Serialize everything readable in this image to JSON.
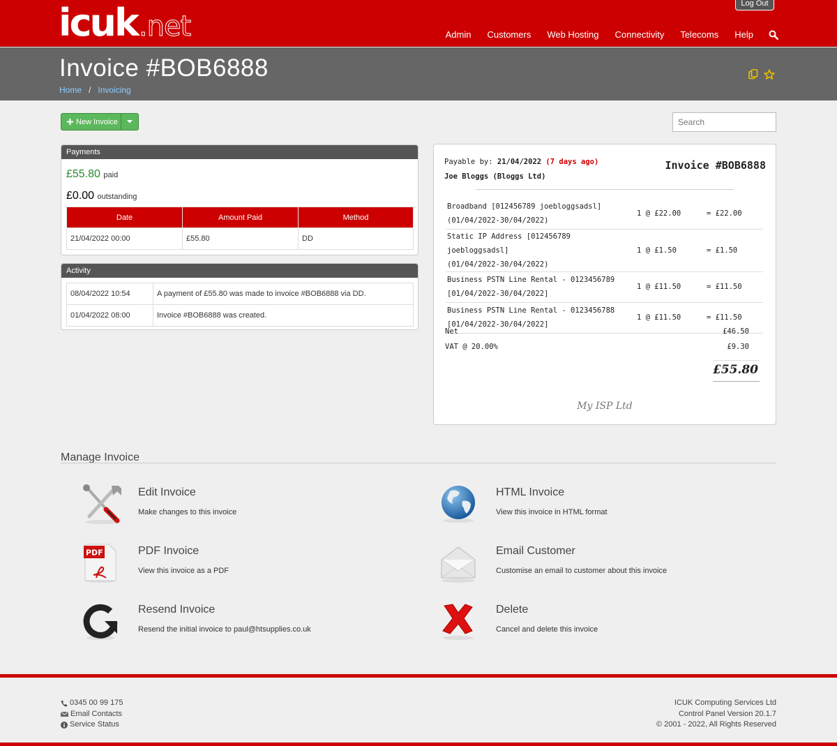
{
  "header": {
    "logo_main": "icuk",
    "logo_suffix": ".net",
    "logout_label": "Log Out",
    "nav": [
      "Admin",
      "Customers",
      "Web Hosting",
      "Connectivity",
      "Telecoms",
      "Help"
    ]
  },
  "titlebar": {
    "title": "Invoice #BOB6888",
    "breadcrumb": [
      "Home",
      "Invoicing"
    ],
    "breadcrumb_sep": "/"
  },
  "toolbar": {
    "new_invoice_label": "New Invoice",
    "search_placeholder": "Search"
  },
  "payments": {
    "heading": "Payments",
    "paid_amount": "£55.80",
    "paid_label": "paid",
    "outstanding_amount": "£0.00",
    "outstanding_label": "outstanding",
    "columns": [
      "Date",
      "Amount Paid",
      "Method"
    ],
    "rows": [
      {
        "date": "21/04/2022 00:00",
        "amount": "£55.80",
        "method": "DD"
      }
    ]
  },
  "activity": {
    "heading": "Activity",
    "rows": [
      {
        "time": "08/04/2022 10:54",
        "text": "A payment of £55.80 was made to invoice #BOB6888 via DD."
      },
      {
        "time": "01/04/2022 08:00",
        "text": "Invoice #BOB6888 was created."
      }
    ]
  },
  "invoice": {
    "payable_label": "Payable by:",
    "payable_date": "21/04/2022",
    "payable_ago": "(7 days ago)",
    "customer": "Joe Bloggs (Bloggs Ltd)",
    "number": "Invoice #BOB6888",
    "lines": [
      {
        "desc1": "Broadband [012456789 joebloggsadsl]",
        "desc2": "(01/04/2022-30/04/2022)",
        "qty": "1 @ £22.00",
        "amount": "= £22.00"
      },
      {
        "desc1": "Static IP Address [012456789 joebloggsadsl]",
        "desc2": "(01/04/2022-30/04/2022)",
        "qty": "1 @ £1.50",
        "amount": "= £1.50"
      },
      {
        "desc1": "Business PSTN Line Rental - 0123456789",
        "desc2": "[01/04/2022-30/04/2022]",
        "qty": "1 @ £11.50",
        "amount": "= £11.50"
      },
      {
        "desc1": "Business PSTN Line Rental - 0123456788",
        "desc2": "[01/04/2022-30/04/2022]",
        "qty": "1 @ £11.50",
        "amount": "= £11.50"
      }
    ],
    "net_label": "Net",
    "net_value": "£46.50",
    "vat_label": "VAT @ 20.00%",
    "vat_value": "£9.30",
    "total": "£55.80",
    "footer": "My ISP Ltd"
  },
  "manage": {
    "heading": "Manage Invoice",
    "actions": [
      {
        "title": "Edit Invoice",
        "desc": "Make changes to this invoice",
        "icon": "tools-icon"
      },
      {
        "title": "HTML Invoice",
        "desc": "View this invoice in HTML format",
        "icon": "globe-icon"
      },
      {
        "title": "PDF Invoice",
        "desc": "View this invoice as a PDF",
        "icon": "pdf-icon",
        "badge": "PDF"
      },
      {
        "title": "Email Customer",
        "desc": "Customise an email to customer about this invoice",
        "icon": "envelope-icon"
      },
      {
        "title": "Resend Invoice",
        "desc": "Resend the initial invoice to paul@htsupplies.co.uk",
        "icon": "resend-icon"
      },
      {
        "title": "Delete",
        "desc": "Cancel and delete this invoice",
        "icon": "delete-x-icon"
      }
    ]
  },
  "footer": {
    "phone": "0345 00 99 175",
    "email": "Email Contacts",
    "status": "Service Status",
    "company": "ICUK Computing Services Ltd",
    "version": "Control Panel Version 20.1.7",
    "copyright": "© 2001 - 2022, All Rights Reserved"
  },
  "colors": {
    "brand_red": "#cc0000",
    "title_band": "#666666",
    "success_green": "#5cb85c",
    "paid_green": "#2a8a2a",
    "link_blue": "#8ecbff"
  }
}
